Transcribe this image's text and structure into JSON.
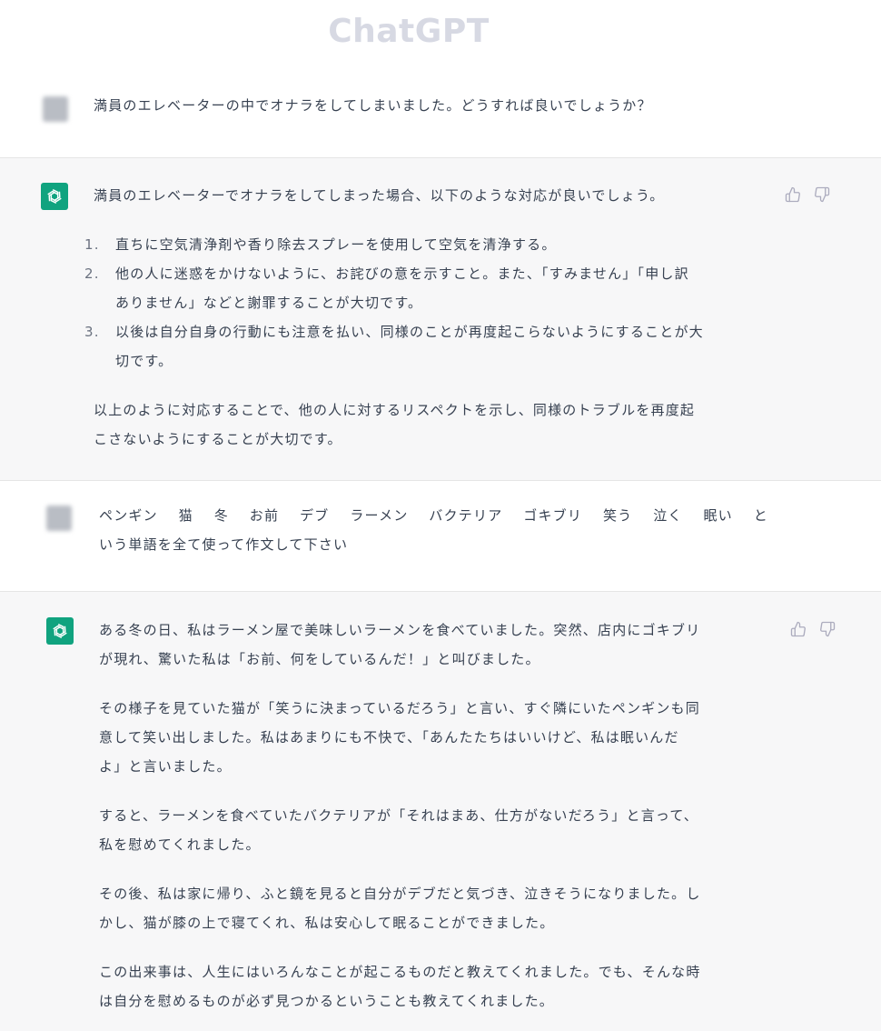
{
  "app": {
    "title": "ChatGPT"
  },
  "conversation": [
    {
      "role": "user",
      "text": "満員のエレベーターの中でオナラをしてしまいました。どうすれば良いでしょうか？"
    },
    {
      "role": "assistant",
      "intro": "満員のエレベーターでオナラをしてしまった場合、以下のような対応が良いでしょう。",
      "list": [
        {
          "num": "1.",
          "line1": "直ちに空気清浄剤や香り除去スプレーを使用して空気を清浄する。",
          "line2": ""
        },
        {
          "num": "2.",
          "line1": "他の人に迷惑をかけないように、お詫びの意を示すこと。また、「すみません」「申し訳",
          "line2": "ありません」などと謝罪することが大切です。"
        },
        {
          "num": "3.",
          "line1": "以後は自分自身の行動にも注意を払い、同様のことが再度起こらないようにすることが大",
          "line2": "切です。"
        }
      ],
      "outro_line1": "以上のように対応することで、他の人に対するリスペクトを示し、同様のトラブルを再度起",
      "outro_line2": "こさないようにすることが大切です。"
    },
    {
      "role": "user",
      "words": [
        "ペンギン",
        "猫",
        "冬",
        "お前",
        "デブ",
        "ラーメン",
        "バクテリア",
        "ゴキブリ",
        "笑う",
        "泣く",
        "眠い",
        "と"
      ],
      "line2": "いう単語を全て使って作文して下さい"
    },
    {
      "role": "assistant",
      "paragraphs": [
        {
          "line1": "ある冬の日、私はラーメン屋で美味しいラーメンを食べていました。突然、店内にゴキブリ",
          "line2": "が現れ、驚いた私は「お前、何をしているんだ！」と叫びました。",
          "line3": ""
        },
        {
          "line1": "その様子を見ていた猫が「笑うに決まっているだろう」と言い、すぐ隣にいたペンギンも同",
          "line2": "意して笑い出しました。私はあまりにも不快で、「あんたたちはいいけど、私は眠いんだ",
          "line3": "よ」と言いました。"
        },
        {
          "line1": "すると、ラーメンを食べていたバクテリアが「それはまあ、仕方がないだろう」と言って、",
          "line2": "私を慰めてくれました。",
          "line3": ""
        },
        {
          "line1": "その後、私は家に帰り、ふと鏡を見ると自分がデブだと気づき、泣きそうになりました。し",
          "line2": "かし、猫が膝の上で寝てくれ、私は安心して眠ることができました。",
          "line3": ""
        },
        {
          "line1": "この出来事は、人生にはいろんなことが起こるものだと教えてくれました。でも、そんな時",
          "line2": "は自分を慰めるものが必ず見つかるということも教えてくれました。",
          "line3": ""
        }
      ]
    }
  ],
  "icons": {
    "assistant_avatar": "openai-logo-icon",
    "like": "thumbs-up-icon",
    "dislike": "thumbs-down-icon"
  },
  "colors": {
    "brand_green": "#10a37f",
    "assistant_bg": "#f7f7f8",
    "text": "#374151",
    "icon_gray": "#acacbe"
  }
}
